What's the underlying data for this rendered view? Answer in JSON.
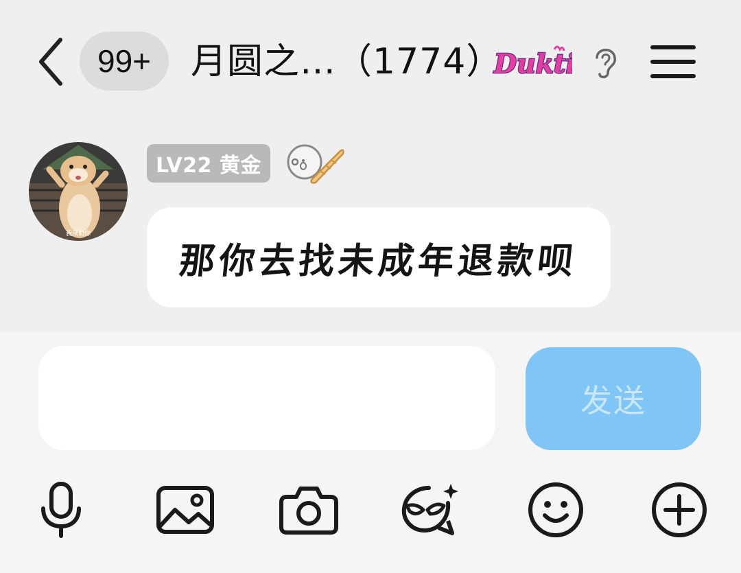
{
  "header": {
    "unread_count": "99+",
    "title": "月圆之…（1774）",
    "brand_badge_text": "Duktig",
    "icons": [
      "back-chevron-icon",
      "ear-icon",
      "menu-icon"
    ]
  },
  "message": {
    "level_badge": "LV22 黄金",
    "text": "那你去找未成年退款呗",
    "avatar_caption": "我来助你",
    "icons": [
      "avatar",
      "medal-icon"
    ]
  },
  "composer": {
    "input_value": "",
    "send_label": "发送",
    "send_color": "#7fc5f5"
  },
  "toolbar": {
    "items": [
      "microphone-icon",
      "image-icon",
      "camera-icon",
      "sticker-face-icon",
      "emoji-icon",
      "plus-icon"
    ]
  },
  "colors": {
    "background": "#efefef",
    "bubble": "#ffffff",
    "level_badge": "#b9b9b9",
    "brand_pink": "#e43fa0",
    "brand_purple": "#6b2c8c"
  }
}
